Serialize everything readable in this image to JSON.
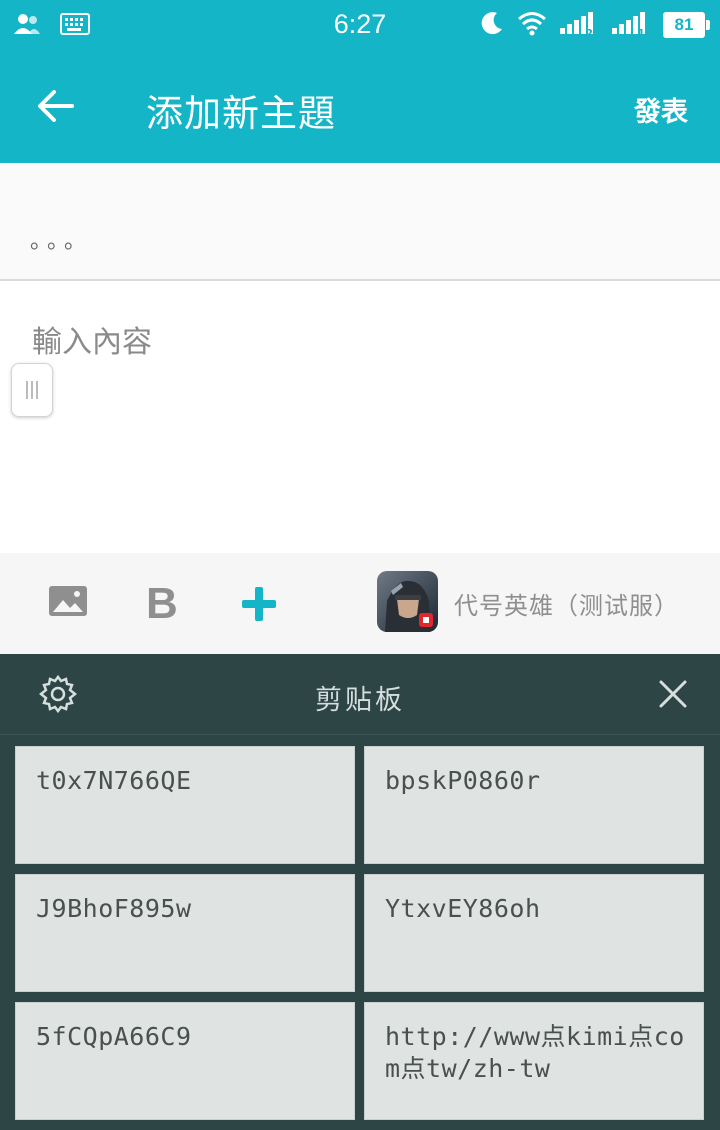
{
  "status_bar": {
    "time": "6:27",
    "battery": "81",
    "sim1_label": "1",
    "sim2_label": "2"
  },
  "app_bar": {
    "title": "添加新主題",
    "publish_label": "發表"
  },
  "subject": {
    "value": "。。。"
  },
  "content": {
    "placeholder": "輸入內容"
  },
  "toolbar": {
    "bold_label": "B",
    "game_name": "代号英雄（测试服）"
  },
  "clipboard": {
    "title": "剪贴板",
    "items": [
      "t0x7N766QE",
      "bpskP0860r",
      "J9BhoF895w",
      "YtxvEY86oh",
      "5fCQpA66C9",
      "http://www点kimi点com点tw/zh-tw"
    ]
  },
  "colors": {
    "accent": "#13B5C6",
    "clipboard_bg": "#2E4545",
    "clip_item_bg": "#DFE3E2"
  }
}
